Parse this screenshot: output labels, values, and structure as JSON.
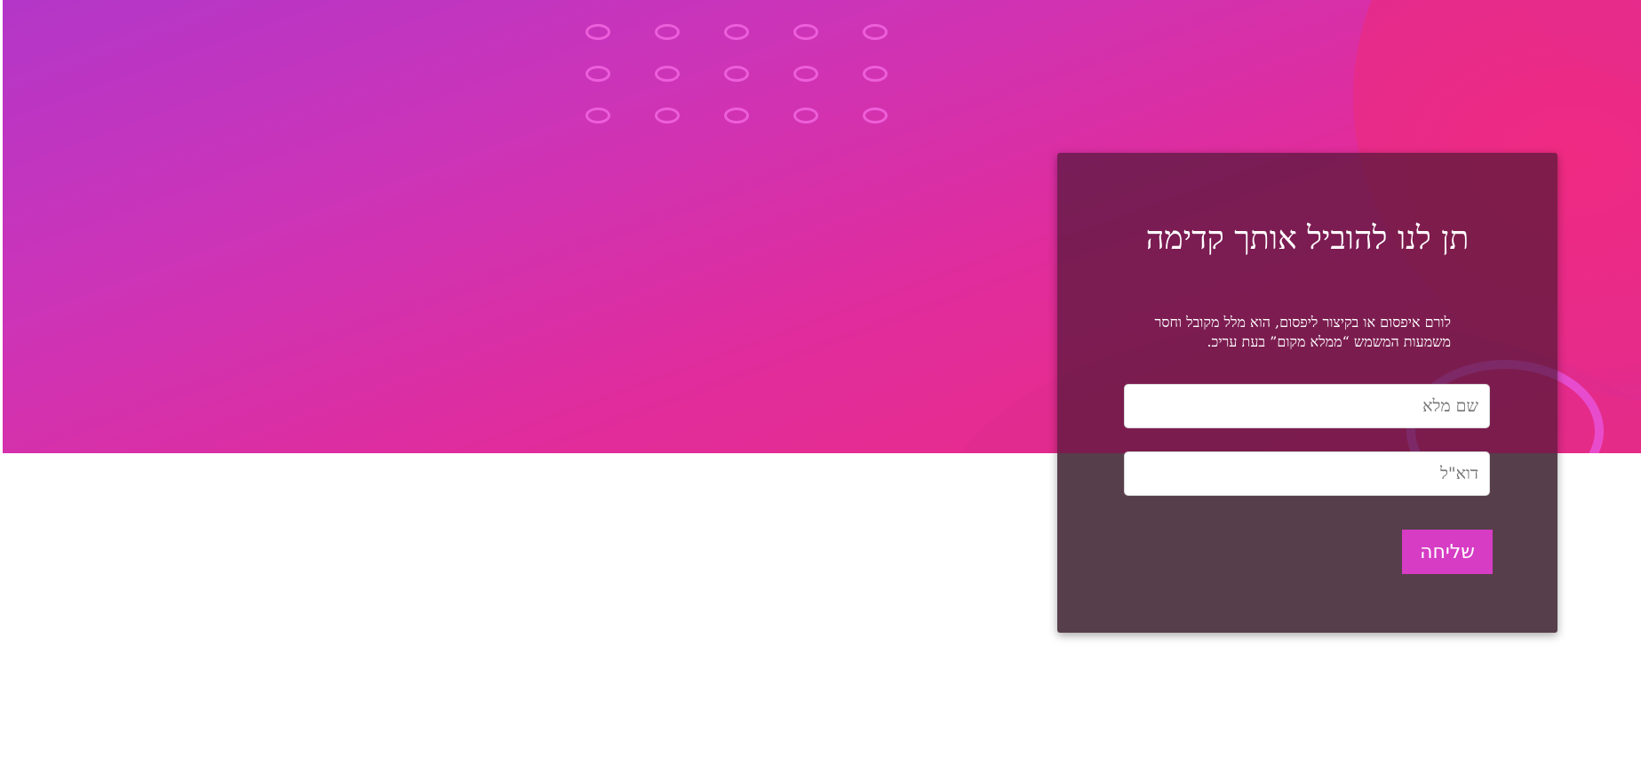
{
  "hero": {
    "colors": {
      "gradient_start": "#b336c8",
      "gradient_end": "#ee2b80",
      "accent_ring": "#f266e0"
    },
    "decoration": "dot-ring-grid"
  },
  "form": {
    "title": "תן לנו להוביל אותך קדימה",
    "description": "לורם איפסום או בקיצור ליפסום, הוא מלל מקובל וחסר משמעות המשמש “ממלא מקום” בעת עריכ.",
    "name_placeholder": "שם מלא",
    "email_placeholder": "דוא\"ל",
    "submit_label": "שליחה",
    "colors": {
      "card_bg": "#3c1428",
      "button": "#d63cc4"
    }
  }
}
